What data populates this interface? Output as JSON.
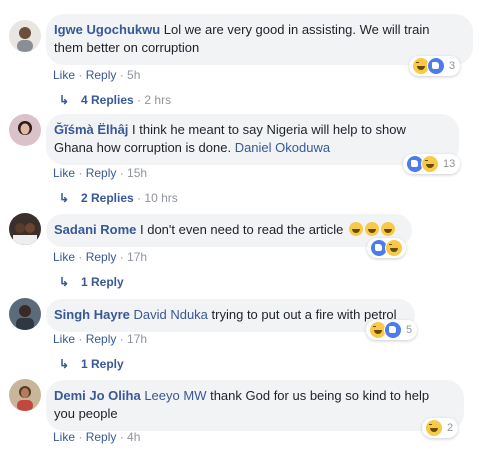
{
  "comments": [
    {
      "author": "Igwe Ugochukwu",
      "text": "Lol we are very good in assisting. We will train them better on corruption",
      "reaction_count": "3",
      "like": "Like",
      "reply": "Reply",
      "time": "5h",
      "replies_label": "4 Replies",
      "replies_time": "2 hrs"
    },
    {
      "author": "Ğĩśmà Ëlhâj",
      "text": "I think he meant to say Nigeria will help to show Ghana how corruption is done.",
      "mention": "Daniel Okoduwa",
      "reaction_count": "13",
      "like": "Like",
      "reply": "Reply",
      "time": "15h",
      "replies_label": "2 Replies",
      "replies_time": "10 hrs"
    },
    {
      "author": "Sadani Rome",
      "text": "I don't even need to read the article",
      "like": "Like",
      "reply": "Reply",
      "time": "17h",
      "replies_label": "1 Reply"
    },
    {
      "author": "Singh Hayre",
      "mention": "David Nduka",
      "text": "trying to put out a fire with petrol",
      "reaction_count": "5",
      "like": "Like",
      "reply": "Reply",
      "time": "17h",
      "replies_label": "1 Reply"
    },
    {
      "author": "Demi Jo Oliha",
      "mention": "Leeyo MW",
      "text": "thank God for us being so kind to help you people",
      "reaction_count": "2",
      "like": "Like",
      "reply": "Reply",
      "time": "4h"
    }
  ],
  "icons": {
    "like_reaction": "like-reaction-icon",
    "haha_reaction": "haha-reaction-icon",
    "reply_arrow": "reply-arrow-icon"
  },
  "colors": {
    "link": "#385898",
    "meta": "#90949c",
    "bubble": "#f2f3f5",
    "like_blue": "#4b7bec",
    "haha_yellow": "#f7c948"
  }
}
